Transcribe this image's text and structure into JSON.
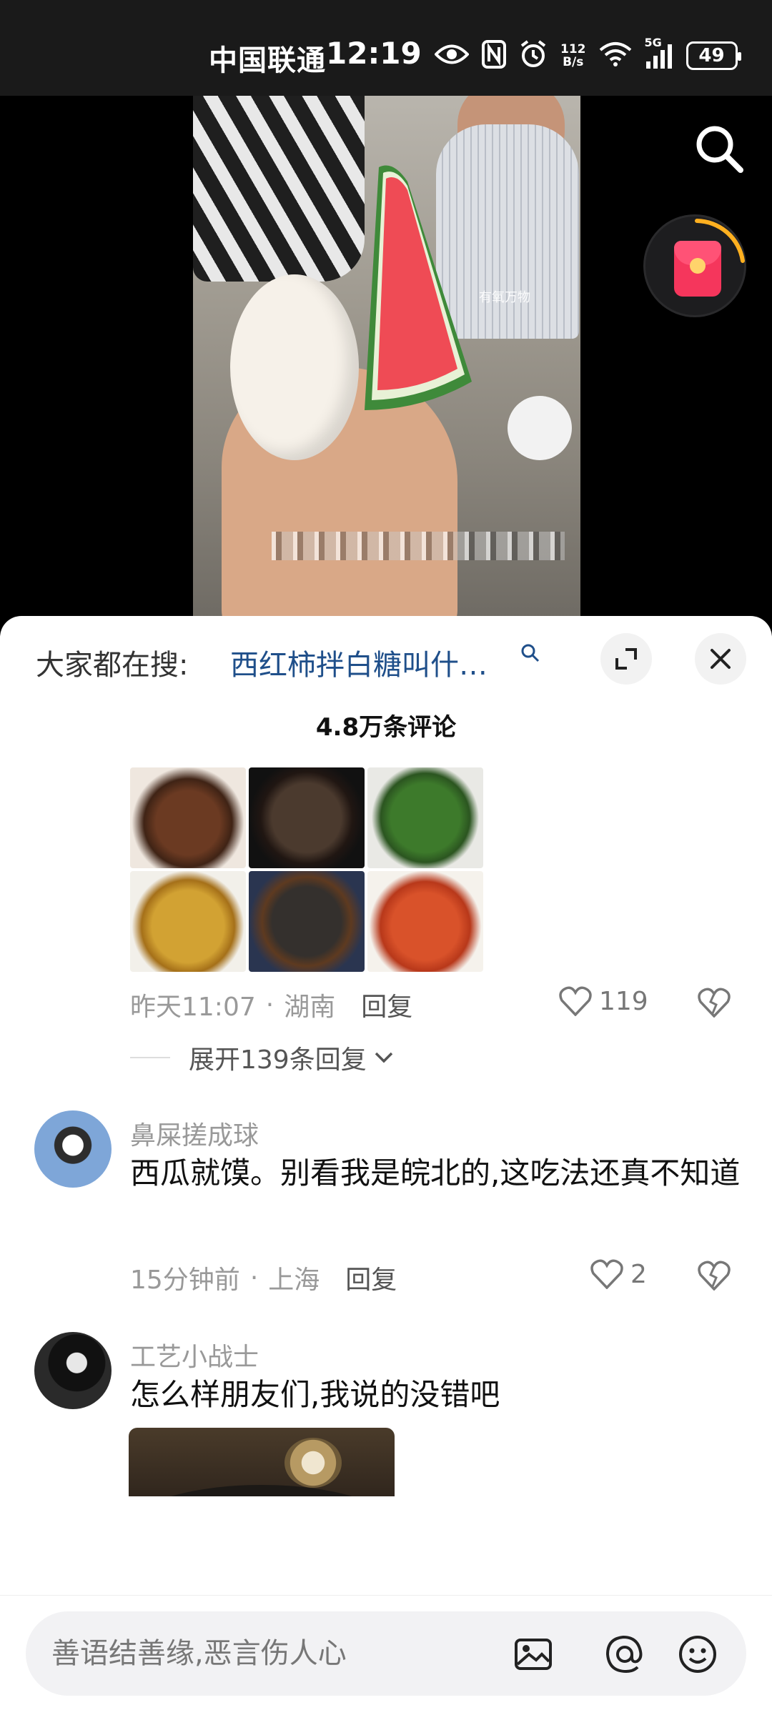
{
  "status_bar": {
    "carrier": "中国联通",
    "time": "12:19",
    "network_speed_value": "112",
    "network_speed_unit": "B/s",
    "network_type": "5G",
    "battery": "49",
    "icons": [
      "eye-icon",
      "nfc-icon",
      "alarm-icon",
      "wifi-icon",
      "signal-icon",
      "battery-icon"
    ]
  },
  "video": {
    "watermark": "有氧万物"
  },
  "sheet": {
    "trending_label": "大家都在搜:",
    "trending_query": "西红柿拌白糖叫什…",
    "comment_count": "4.8万条评论"
  },
  "comments": [
    {
      "time": "昨天11:07",
      "location": "湖南",
      "reply_label": "回复",
      "likes": "119",
      "expand_replies": "展开139条回复"
    },
    {
      "username": "鼻屎搓成球",
      "text": "西瓜就馍。别看我是皖北的,这吃法还真不知道",
      "time": "15分钟前",
      "location": "上海",
      "reply_label": "回复",
      "likes": "2"
    },
    {
      "username": "工艺小战士",
      "text": "怎么样朋友们,我说的没错吧"
    }
  ],
  "input_bar": {
    "placeholder": "善语结善缘,恶言伤人心"
  },
  "colors": {
    "accent_link": "#1f4f8a",
    "red_packet": "#f5365c",
    "ring": "#ffb020"
  }
}
